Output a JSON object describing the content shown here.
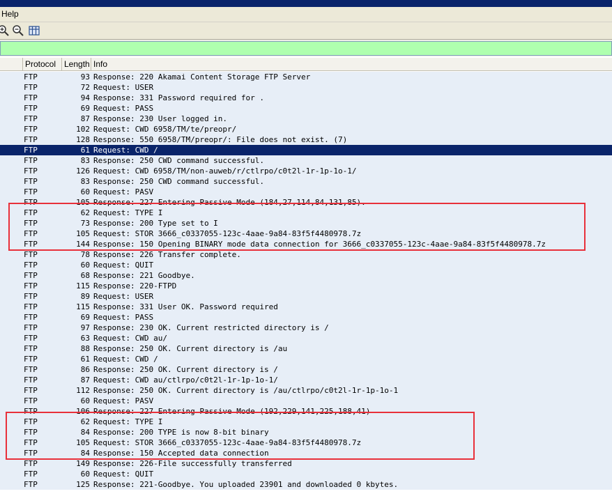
{
  "menu": {
    "help_label": "Help"
  },
  "toolbar": {
    "icons": [
      "zoom-in-icon",
      "zoom-out-icon",
      "resize-columns-icon"
    ]
  },
  "filter": {
    "value": "",
    "bg_color": "#afffaf"
  },
  "columns": {
    "protocol": "Protocol",
    "length": "Length",
    "info": "Info"
  },
  "colors": {
    "row_bg": "#e7eef7",
    "selected_bg": "#0a246a",
    "highlight_border": "#e8303a"
  },
  "selected_row": 7,
  "packets": [
    {
      "protocol": "FTP",
      "length": "93",
      "info": "Response: 220 Akamai Content Storage FTP Server"
    },
    {
      "protocol": "FTP",
      "length": "72",
      "info": "Request: USER"
    },
    {
      "protocol": "FTP",
      "length": "94",
      "info": "Response: 331 Password required for ."
    },
    {
      "protocol": "FTP",
      "length": "69",
      "info": "Request: PASS"
    },
    {
      "protocol": "FTP",
      "length": "87",
      "info": "Response: 230 User logged in."
    },
    {
      "protocol": "FTP",
      "length": "102",
      "info": "Request: CWD 6958/TM/te/preopr/"
    },
    {
      "protocol": "FTP",
      "length": "128",
      "info": "Response: 550 6958/TM/preopr/: File does not exist. (7)"
    },
    {
      "protocol": "FTP",
      "length": "61",
      "info": "Request: CWD /"
    },
    {
      "protocol": "FTP",
      "length": "83",
      "info": "Response: 250 CWD command successful."
    },
    {
      "protocol": "FTP",
      "length": "126",
      "info": "Request: CWD 6958/TM/non-auweb/r/ctlrpo/c0t2l-1r-1p-1o-1/"
    },
    {
      "protocol": "FTP",
      "length": "83",
      "info": "Response: 250 CWD command successful."
    },
    {
      "protocol": "FTP",
      "length": "60",
      "info": "Request: PASV"
    },
    {
      "protocol": "FTP",
      "length": "105",
      "info": "Response: 227 Entering Passive Mode (184,27,114,84,131,85)."
    },
    {
      "protocol": "FTP",
      "length": "62",
      "info": "Request: TYPE I"
    },
    {
      "protocol": "FTP",
      "length": "73",
      "info": "Response: 200 Type set to I"
    },
    {
      "protocol": "FTP",
      "length": "105",
      "info": "Request: STOR 3666_c0337055-123c-4aae-9a84-83f5f4480978.7z"
    },
    {
      "protocol": "FTP",
      "length": "144",
      "info": "Response: 150 Opening BINARY mode data connection for 3666_c0337055-123c-4aae-9a84-83f5f4480978.7z"
    },
    {
      "protocol": "FTP",
      "length": "78",
      "info": "Response: 226 Transfer complete."
    },
    {
      "protocol": "FTP",
      "length": "60",
      "info": "Request: QUIT"
    },
    {
      "protocol": "FTP",
      "length": "68",
      "info": "Response: 221 Goodbye."
    },
    {
      "protocol": "FTP",
      "length": "115",
      "info": "Response: 220-FTPD"
    },
    {
      "protocol": "FTP",
      "length": "89",
      "info": "Request: USER"
    },
    {
      "protocol": "FTP",
      "length": "115",
      "info": "Response: 331 User OK. Password required"
    },
    {
      "protocol": "FTP",
      "length": "69",
      "info": "Request: PASS"
    },
    {
      "protocol": "FTP",
      "length": "97",
      "info": "Response: 230 OK. Current restricted directory is /"
    },
    {
      "protocol": "FTP",
      "length": "63",
      "info": "Request: CWD au/"
    },
    {
      "protocol": "FTP",
      "length": "88",
      "info": "Response: 250 OK. Current directory is /au"
    },
    {
      "protocol": "FTP",
      "length": "61",
      "info": "Request: CWD /"
    },
    {
      "protocol": "FTP",
      "length": "86",
      "info": "Response: 250 OK. Current directory is /"
    },
    {
      "protocol": "FTP",
      "length": "87",
      "info": "Request: CWD au/ctlrpo/c0t2l-1r-1p-1o-1/"
    },
    {
      "protocol": "FTP",
      "length": "112",
      "info": "Response: 250 OK. Current directory is /au/ctlrpo/c0t2l-1r-1p-1o-1"
    },
    {
      "protocol": "FTP",
      "length": "60",
      "info": "Request: PASV"
    },
    {
      "protocol": "FTP",
      "length": "106",
      "info": "Response: 227 Entering Passive Mode (192,229,141,225,188,41)"
    },
    {
      "protocol": "FTP",
      "length": "62",
      "info": "Request: TYPE I"
    },
    {
      "protocol": "FTP",
      "length": "84",
      "info": "Response: 200 TYPE is now 8-bit binary"
    },
    {
      "protocol": "FTP",
      "length": "105",
      "info": "Request: STOR 3666_c0337055-123c-4aae-9a84-83f5f4480978.7z"
    },
    {
      "protocol": "FTP",
      "length": "84",
      "info": "Response: 150 Accepted data connection"
    },
    {
      "protocol": "FTP",
      "length": "149",
      "info": "Response: 226-File successfully transferred"
    },
    {
      "protocol": "FTP",
      "length": "60",
      "info": "Request: QUIT"
    },
    {
      "protocol": "FTP",
      "length": "125",
      "info": "Response: 221-Goodbye. You uploaded 23901 and downloaded 0 kbytes."
    }
  ],
  "highlight_groups": [
    {
      "first_row": 13,
      "last_row": 16
    },
    {
      "first_row": 33,
      "last_row": 36
    }
  ]
}
